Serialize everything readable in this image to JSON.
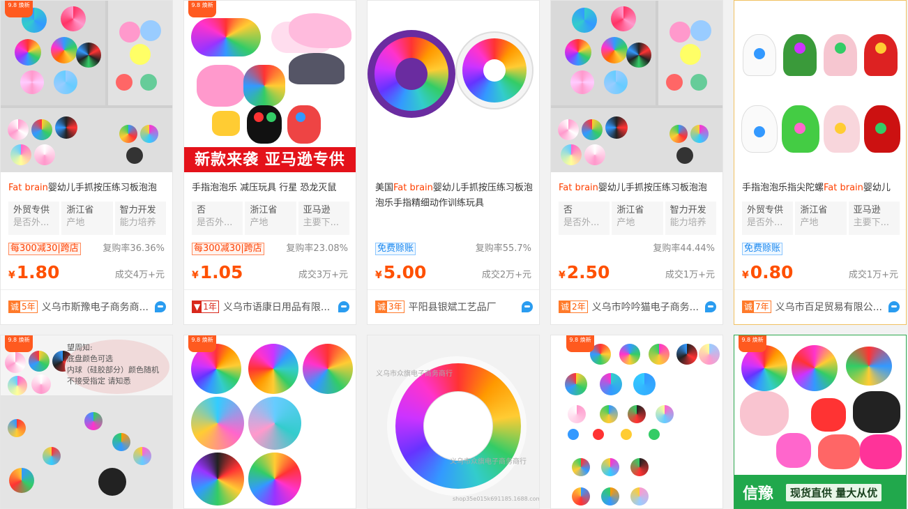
{
  "promo_badge": "9.8 焕新",
  "cards": [
    {
      "title_pre": "",
      "title_hl": "Fat brain",
      "title_post": "婴幼儿手抓按压练习板泡泡",
      "attrs": [
        {
          "v": "外贸专供",
          "k": "是否外..."
        },
        {
          "v": "浙江省",
          "k": "产地"
        },
        {
          "v": "智力开发",
          "k": "能力培养"
        }
      ],
      "promo": "每300减30|跨店",
      "repurchase": "复购率36.36%",
      "currency": "¥",
      "price": "1.80",
      "deal": "成交4万+元",
      "cheng_year": "5年",
      "seller": "义乌市斯豫电子商务商..."
    },
    {
      "title_pre": "手指泡泡乐 减压玩具 行星 恐龙灭鼠",
      "title_hl": "",
      "title_post": "",
      "attrs": [
        {
          "v": "否",
          "k": "是否外..."
        },
        {
          "v": "浙江省",
          "k": "产地"
        },
        {
          "v": "亚马逊",
          "k": "主要下..."
        }
      ],
      "promo": "每300减30|跨店",
      "repurchase": "复购率23.08%",
      "currency": "¥",
      "price": "1.05",
      "deal": "成交3万+元",
      "cheng_year": "1年",
      "seller": "义乌市语康日用品有限...",
      "banner": "新款来袭 亚马逊专供"
    },
    {
      "title_pre": "美国",
      "title_hl": "Fat brain",
      "title_post": "婴幼儿手抓按压练习板泡泡乐手指精细动作训练玩具",
      "attrs": [],
      "promo": "免费赊账",
      "repurchase": "复购率55.7%",
      "currency": "¥",
      "price": "5.00",
      "deal": "成交2万+元",
      "cheng_year": "3年",
      "seller": "平阳县银斌工艺品厂"
    },
    {
      "title_pre": "",
      "title_hl": "Fat brain",
      "title_post": "婴幼儿手抓按压练习板泡泡",
      "attrs": [
        {
          "v": "否",
          "k": "是否外..."
        },
        {
          "v": "浙江省",
          "k": "产地"
        },
        {
          "v": "智力开发",
          "k": "能力培养"
        }
      ],
      "promo": "",
      "repurchase": "复购率44.44%",
      "currency": "¥",
      "price": "2.50",
      "deal": "成交1万+元",
      "cheng_year": "2年",
      "seller": "义乌市吟吟猫电子商务..."
    },
    {
      "title_pre": "手指泡泡乐指尖陀螺",
      "title_hl": "Fat brain",
      "title_post": "婴幼儿",
      "attrs": [
        {
          "v": "外贸专供",
          "k": "是否外..."
        },
        {
          "v": "浙江省",
          "k": "产地"
        },
        {
          "v": "亚马逊",
          "k": "主要下..."
        }
      ],
      "promo": "免费赊账",
      "repurchase": "",
      "currency": "¥",
      "price": "0.80",
      "deal": "成交1万+元",
      "cheng_year": "7年",
      "seller": "义乌市百足贸易有限公..."
    }
  ],
  "row2": {
    "note": [
      "望周知:",
      "底盘颜色可选",
      "内球（硅胶部分）颜色随机",
      "不接受指定 请知悉"
    ],
    "watermark1": "义乌市众旗电子商务商行",
    "watermark2": "shop35e015k691185.1688.com",
    "green_banner_1": "信豫",
    "green_banner_2": "现货直供 量大从优"
  },
  "colors": {
    "accent": "#ff5000",
    "brand_red": "#e4121a",
    "link_blue": "#1a88f0"
  }
}
